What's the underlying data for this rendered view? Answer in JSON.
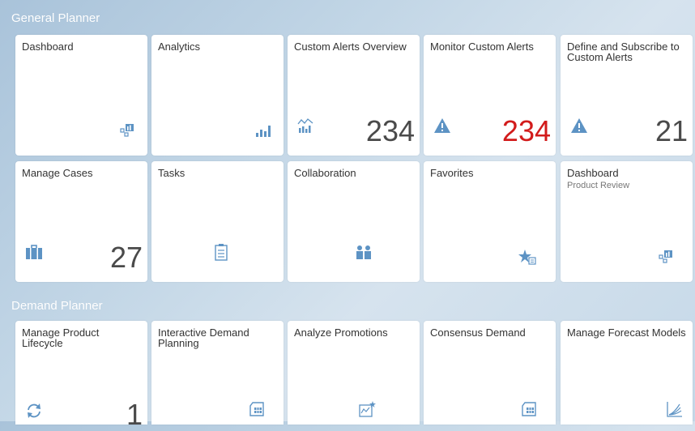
{
  "groups": {
    "general": "General Planner",
    "demand": "Demand Planner"
  },
  "colors": {
    "icon_blue": "#5d93c4",
    "alert_red": "#d21b1b"
  },
  "tiles": [
    {
      "title": "Dashboard",
      "icon": "dashboard-icon"
    },
    {
      "title": "Analytics",
      "icon": "bar-chart-icon"
    },
    {
      "title": "Custom Alerts Overview",
      "icon": "line-bar-chart-icon",
      "number": "234"
    },
    {
      "title": "Monitor Custom Alerts",
      "icon": "warning-icon",
      "number": "234"
    },
    {
      "title": "Define and Subscribe to Custom Alerts",
      "icon": "warning-icon",
      "number": "21"
    },
    {
      "title": "Manage Cases",
      "icon": "briefcase-icon",
      "number": "27"
    },
    {
      "title": "Tasks",
      "icon": "task-clipboard-icon"
    },
    {
      "title": "Collaboration",
      "icon": "people-icon"
    },
    {
      "title": "Favorites",
      "icon": "star-list-icon"
    },
    {
      "title": "Dashboard",
      "subtitle": "Product Review",
      "icon": "dashboard-icon"
    },
    {
      "title": "Manage Product Lifecycle",
      "icon": "refresh-icon",
      "number": "1"
    },
    {
      "title": "Interactive Demand Planning",
      "icon": "spreadsheet-icon"
    },
    {
      "title": "Analyze Promotions",
      "icon": "promo-chart-icon"
    },
    {
      "title": "Consensus Demand",
      "icon": "spreadsheet-icon"
    },
    {
      "title": "Manage Forecast Models",
      "icon": "forecast-model-icon"
    }
  ]
}
